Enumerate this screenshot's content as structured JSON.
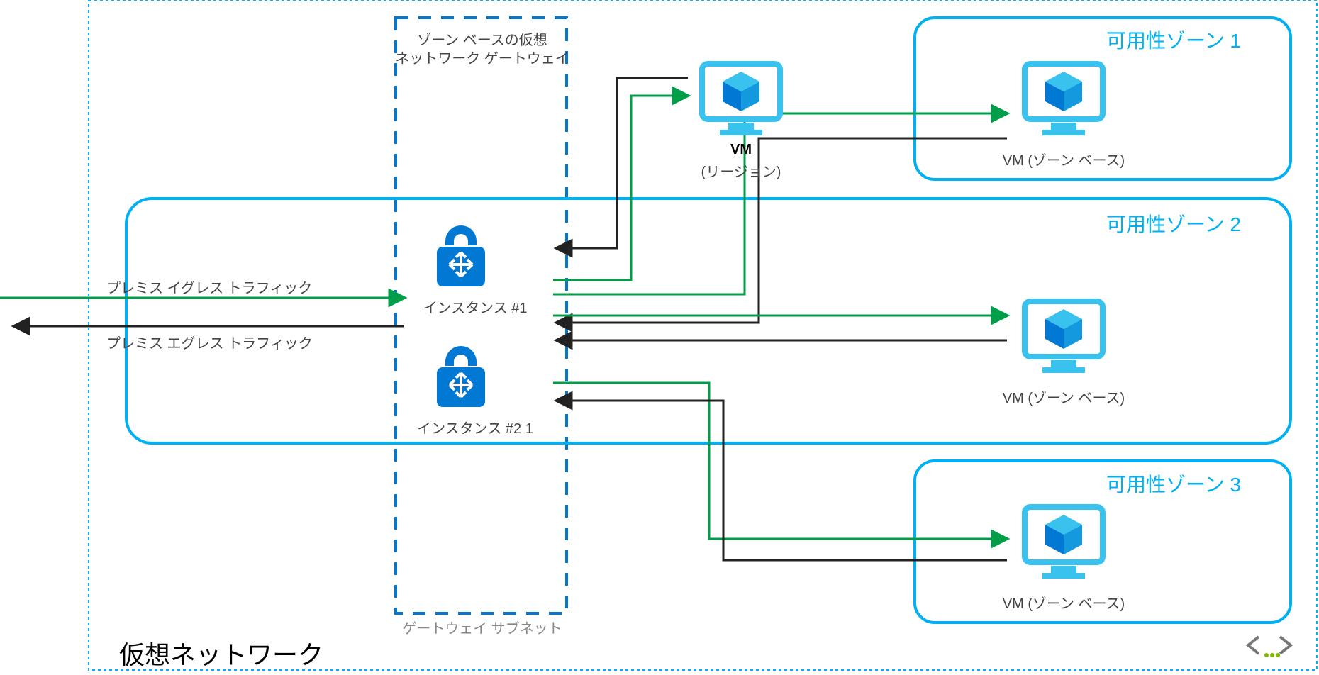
{
  "vnet_title": "仮想ネットワーク",
  "gateway_subnet_label": "ゲートウェイ サブネット",
  "gateway_box": {
    "line1": "ゾーン ベースの仮想",
    "line2": "ネットワーク ゲートウェイ"
  },
  "instance1_label": "インスタンス #1",
  "instance2_label": "インスタンス #2 1",
  "traffic": {
    "ingress": "プレミス イグレス トラフィック",
    "egress": "プレミス エグレス トラフィック"
  },
  "vm_region": {
    "title": "VM",
    "subtitle": "(リージョン)"
  },
  "vm_zone_label": "VM (ゾーン ベース)",
  "zones": {
    "z1": "可用性ゾーン 1",
    "z2": "可用性ゾーン 2",
    "z3": "可用性ゾーン 3"
  },
  "colors": {
    "azure_blue": "#0078d4",
    "light_blue": "#00b0f0",
    "green": "#009e49",
    "black": "#222222",
    "gray": "#777777"
  }
}
